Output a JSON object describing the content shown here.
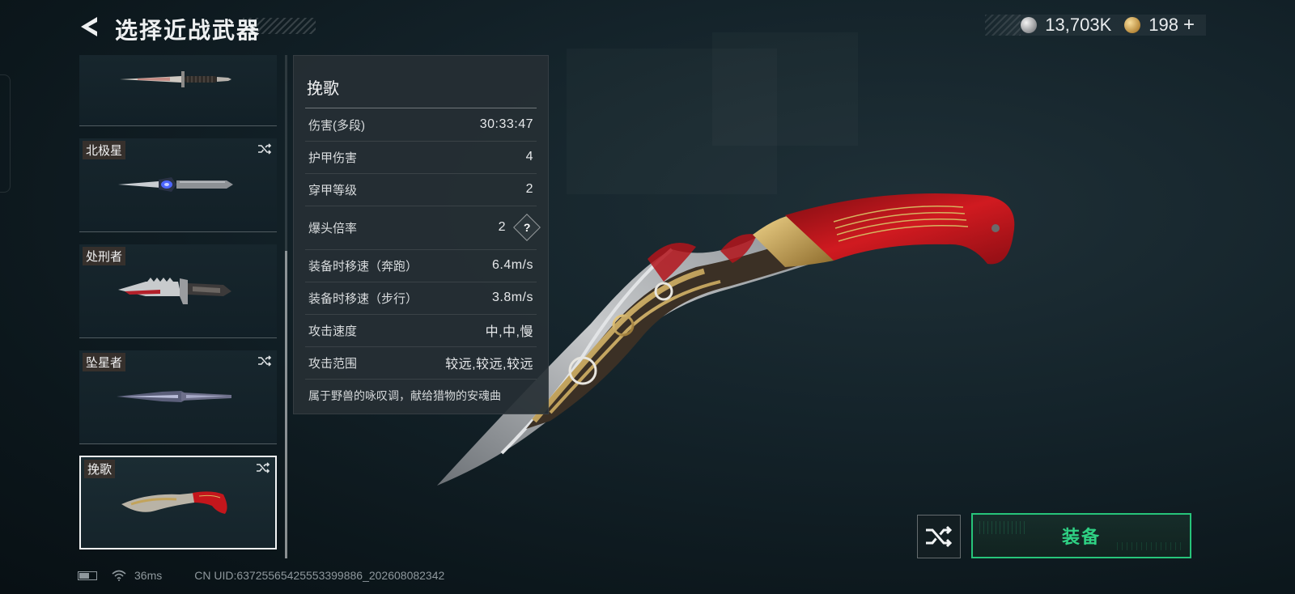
{
  "header": {
    "title": "选择近战武器",
    "silver_amount": "13,703K",
    "gold_amount": "198",
    "gold_plus": "+"
  },
  "weapons": [
    {
      "name": "",
      "selected": false,
      "shuffle": false
    },
    {
      "name": "北极星",
      "selected": false,
      "shuffle": true
    },
    {
      "name": "处刑者",
      "selected": false,
      "shuffle": false
    },
    {
      "name": "坠星者",
      "selected": false,
      "shuffle": true
    },
    {
      "name": "挽歌",
      "selected": true,
      "shuffle": true
    }
  ],
  "stats_panel": {
    "title": "挽歌",
    "rows": [
      {
        "label": "伤害(多段)",
        "value": "30:33:47"
      },
      {
        "label": "护甲伤害",
        "value": "4"
      },
      {
        "label": "穿甲等级",
        "value": "2"
      },
      {
        "label": "爆头倍率",
        "value": "2",
        "help": "?"
      },
      {
        "label": "装备时移速（奔跑）",
        "value": "6.4m/s"
      },
      {
        "label": "装备时移速（步行）",
        "value": "3.8m/s"
      },
      {
        "label": "攻击速度",
        "value": "中,中,慢"
      },
      {
        "label": "攻击范围",
        "value": "较远,较远,较远"
      }
    ],
    "description": "属于野兽的咏叹调，献给猎物的安魂曲"
  },
  "actions": {
    "equip_label": "装备"
  },
  "status_bar": {
    "ping": "36ms",
    "uid": "CN UID:637255654255533998​86_202608082342"
  },
  "colors": {
    "accent_green": "#2fd184",
    "panel_bg": "#262f34",
    "blade_red": "#c4161c"
  },
  "icons": [
    "back-arrow-icon",
    "silver-coin-icon",
    "gold-coin-icon",
    "shuffle-icon",
    "help-icon",
    "battery-icon",
    "wifi-icon"
  ]
}
